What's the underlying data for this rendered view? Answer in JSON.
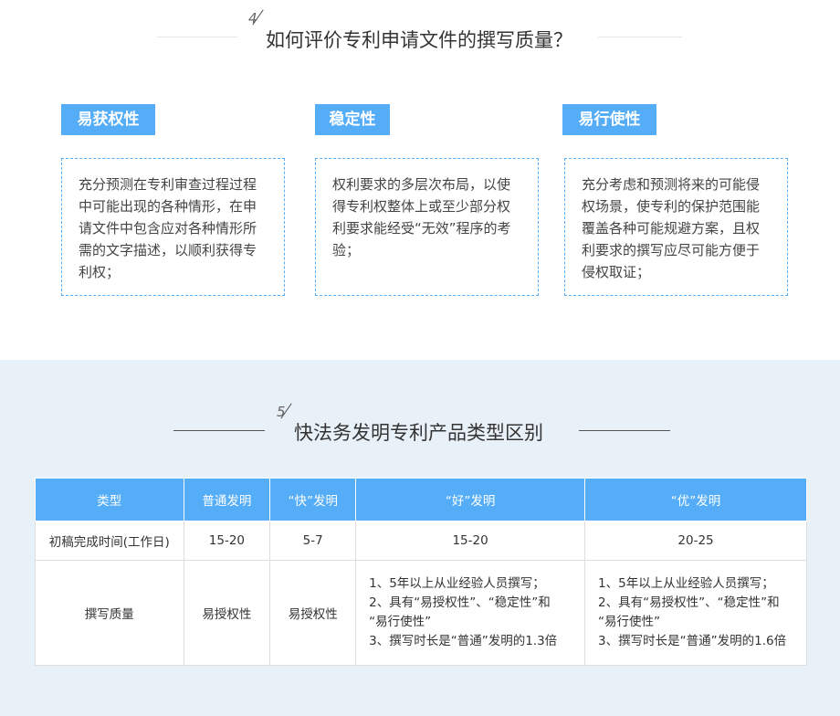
{
  "section4": {
    "number": "4",
    "title": "如何评价专利申请文件的撰写质量？",
    "cards": [
      {
        "label": "易获权性",
        "text": "充分预测在专利审查过程过程中可能出现的各种情形，在申请文件中包含应对各种情形所需的文字描述，以顺利获得专利权；"
      },
      {
        "label": "稳定性",
        "text": "权利要求的多层次布局，以使得专利权整体上或至少部分权利要求能经受“无效”程序的考验；"
      },
      {
        "label": "易行使性",
        "text": "充分考虑和预测将来的可能侵权场景，使专利的保护范围能覆盖各种可能规避方案，且权利要求的撰写应尽可能方便于侵权取证；"
      }
    ]
  },
  "section5": {
    "number": "5",
    "title": "快法务发明专利产品类型区别",
    "table": {
      "headers": [
        "类型",
        "普通发明",
        "“快”发明",
        "“好”发明",
        "“优”发明"
      ],
      "row1": [
        "初稿完成时间(工作日)",
        "15-20",
        "5-7",
        "15-20",
        "20-25"
      ],
      "row2": {
        "label": "撰写质量",
        "c1": "易授权性",
        "c2": "易授权性",
        "c3": [
          "1、5年以上从业经验人员撰写；",
          "2、具有“易授权性”、“稳定性”和",
          "“易行使性”",
          "3、撰写时长是“普通”发明的1.3倍"
        ],
        "c4": [
          "1、5年以上从业经验人员撰写；",
          "2、具有“易授权性”、“稳定性”和",
          "“易行使性”",
          "3、撰写时长是“普通”发明的1.6倍"
        ]
      }
    }
  }
}
